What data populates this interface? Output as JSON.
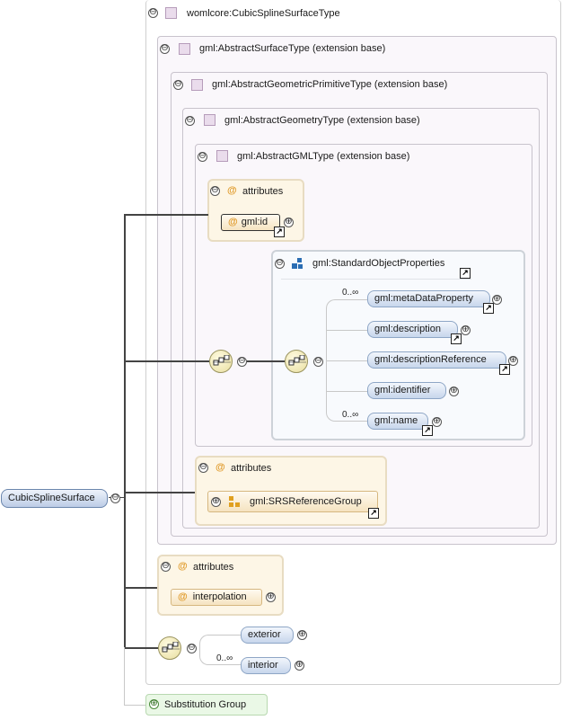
{
  "types": {
    "womlcore": "womlcore:CubicSplineSurfaceType",
    "surface": "gml:AbstractSurfaceType (extension base)",
    "primitive": "gml:AbstractGeometricPrimitiveType (extension base)",
    "geometry": "gml:AbstractGeometryType (extension base)",
    "gml": "gml:AbstractGMLType (extension base)"
  },
  "attributes_label": "attributes",
  "gml_id": "gml:id",
  "standard_object_properties": "gml:StandardObjectProperties",
  "sop_elements": [
    {
      "name": "gml:metaDataProperty",
      "occurs": "0..∞"
    },
    {
      "name": "gml:description",
      "occurs": ""
    },
    {
      "name": "gml:descriptionReference",
      "occurs": ""
    },
    {
      "name": "gml:identifier",
      "occurs": ""
    },
    {
      "name": "gml:name",
      "occurs": "0..∞"
    }
  ],
  "srs_reference_group": "gml:SRSReferenceGroup",
  "interpolation": "interpolation",
  "exterior": "exterior",
  "interior": "interior",
  "interior_occurs": "0..∞",
  "root": "CubicSplineSurface",
  "substitution_group": "Substitution Group",
  "icons": {
    "collapse": "⊖",
    "expand": "⊕",
    "ref": "↗",
    "attribute": "@"
  }
}
